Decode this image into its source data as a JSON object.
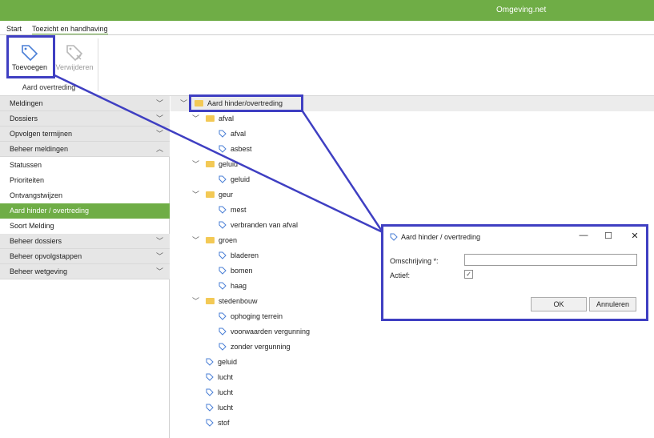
{
  "app": {
    "title": "Omgeving.net"
  },
  "menu": {
    "items": [
      "Start",
      "Toezicht en handhaving"
    ]
  },
  "ribbon": {
    "add_label": "Toevoegen",
    "delete_label": "Verwijderen",
    "group_label": "Aard overtreding"
  },
  "sidebar": {
    "items": [
      {
        "label": "Meldingen",
        "chevron": "﹀"
      },
      {
        "label": "Dossiers",
        "chevron": "﹀"
      },
      {
        "label": "Opvolgen termijnen",
        "chevron": "﹀"
      },
      {
        "label": "Beheer meldingen",
        "chevron": "︿"
      },
      {
        "label": "Statussen"
      },
      {
        "label": "Prioriteiten"
      },
      {
        "label": "Ontvangstwijzen"
      },
      {
        "label": "Aard hinder / overtreding"
      },
      {
        "label": "Soort Melding"
      },
      {
        "label": "Beheer dossiers",
        "chevron": "﹀"
      },
      {
        "label": "Beheer opvolgstappen",
        "chevron": "﹀"
      },
      {
        "label": "Beheer wetgeving",
        "chevron": "﹀"
      }
    ]
  },
  "tree": {
    "root": "Aard hinder/overtreding",
    "nodes": [
      "afval",
      "afval",
      "asbest",
      "geluid",
      "geluid",
      "geur",
      "mest",
      "verbranden van afval",
      "groen",
      "bladeren",
      "bomen",
      "haag",
      "stedenbouw",
      "ophoging terrein",
      "voorwaarden vergunning",
      "zonder vergunning",
      "geluid",
      "lucht",
      "lucht",
      "lucht",
      "stof"
    ]
  },
  "dialog": {
    "title": "Aard hinder / overtreding",
    "minimize": "—",
    "maximize": "☐",
    "close": "✕",
    "description_label": "Omschrijving *:",
    "description_value": "",
    "active_label": "Actief:",
    "active_checked": "✓",
    "ok_label": "OK",
    "cancel_label": "Annuleren"
  },
  "colors": {
    "accent": "#6fad46",
    "highlight": "#3f3fc2",
    "folder": "#f3c955",
    "tag": "#4a7fd6"
  }
}
